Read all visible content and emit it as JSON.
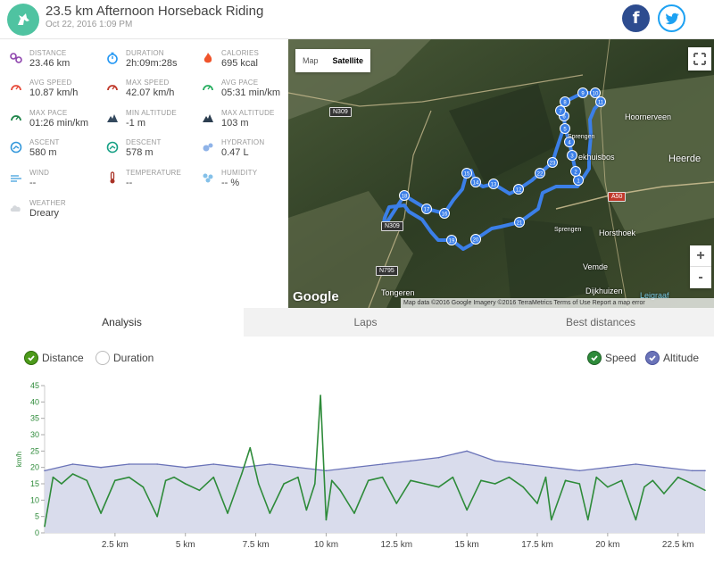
{
  "header": {
    "title": "23.5 km Afternoon Horseback Riding",
    "date": "Oct 22, 2016 1:09 PM"
  },
  "social": {
    "facebook_glyph": "f",
    "twitter_icon": "twitter-bird-icon"
  },
  "stats": [
    {
      "label": "DISTANCE",
      "value": "23.46 km",
      "icon": "route-icon",
      "color": "#8e44ad"
    },
    {
      "label": "DURATION",
      "value": "2h:09m:28s",
      "icon": "stopwatch-icon",
      "color": "#2196f3"
    },
    {
      "label": "CALORIES",
      "value": "695 kcal",
      "icon": "flame-icon",
      "color": "#f0542b"
    },
    {
      "label": "AVG SPEED",
      "value": "10.87 km/h",
      "icon": "speedometer-icon",
      "color": "#e74c3c"
    },
    {
      "label": "MAX SPEED",
      "value": "42.07 km/h",
      "icon": "speedometer-icon",
      "color": "#c0392b"
    },
    {
      "label": "AVG PACE",
      "value": "05:31 min/km",
      "icon": "gauge-icon",
      "color": "#27ae60"
    },
    {
      "label": "MAX PACE",
      "value": "01:26 min/km",
      "icon": "gauge-icon",
      "color": "#1e8449"
    },
    {
      "label": "MIN ALTITUDE",
      "value": "-1 m",
      "icon": "mountain-icon",
      "color": "#34495e"
    },
    {
      "label": "MAX ALTITUDE",
      "value": "103 m",
      "icon": "mountain-icon",
      "color": "#2c3e50"
    },
    {
      "label": "ASCENT",
      "value": "580 m",
      "icon": "ascent-icon",
      "color": "#3498db"
    },
    {
      "label": "DESCENT",
      "value": "578 m",
      "icon": "descent-icon",
      "color": "#16a085"
    },
    {
      "label": "HYDRATION",
      "value": "0.47 L",
      "icon": "drops-icon",
      "color": "#8fb3e8"
    },
    {
      "label": "WIND",
      "value": "--",
      "icon": "wind-icon",
      "color": "#5dade2"
    },
    {
      "label": "TEMPERATURE",
      "value": "--",
      "icon": "thermometer-icon",
      "color": "#a93226"
    },
    {
      "label": "HUMIDITY",
      "value": "-- %",
      "icon": "humidity-icon",
      "color": "#85c1e9"
    },
    {
      "label": "WEATHER",
      "value": "Dreary",
      "icon": "cloud-icon",
      "color": "#d5d8dc"
    }
  ],
  "map": {
    "toggle": [
      "Map",
      "Satellite"
    ],
    "active_toggle": "Satellite",
    "zoom_in": "+",
    "zoom_out": "-",
    "google": "Google",
    "attribution": "Map data ©2016 Google Imagery ©2016 TerraMetrics    Terms of Use    Report a map error",
    "places": [
      "Hoornerveen",
      "Heerde",
      "Horsthoek",
      "Vemde",
      "Dijkhuizen",
      "Tongeren",
      "Leigraaf",
      "Sprengen",
      "Sprengen",
      "ekhuisbos"
    ],
    "roads": [
      "N309",
      "N309",
      "N795",
      "A50"
    ],
    "waypoints": [
      "1",
      "2",
      "3",
      "4",
      "5",
      "6",
      "7",
      "8",
      "9",
      "10",
      "11",
      "12",
      "13",
      "14",
      "15",
      "16",
      "17",
      "18",
      "19",
      "20",
      "21",
      "22",
      "23"
    ]
  },
  "tabs": [
    {
      "label": "Analysis",
      "active": true
    },
    {
      "label": "Laps",
      "active": false
    },
    {
      "label": "Best distances",
      "active": false
    }
  ],
  "legend": {
    "x_options": [
      {
        "label": "Distance",
        "checked": true
      },
      {
        "label": "Duration",
        "checked": false
      }
    ],
    "series": [
      {
        "label": "Speed",
        "checked": true
      },
      {
        "label": "Altitude",
        "checked": true
      }
    ]
  },
  "chart_data": {
    "type": "line",
    "ylabel": "km/h",
    "xlabel": "",
    "ylim": [
      0,
      45
    ],
    "yticks": [
      0,
      5,
      10,
      15,
      20,
      25,
      30,
      35,
      40,
      45
    ],
    "xlim": [
      0,
      23.46
    ],
    "xticks": [
      "2.5 km",
      "5 km",
      "7.5 km",
      "10 km",
      "12.5 km",
      "15 km",
      "17.5 km",
      "20 km",
      "22.5 km"
    ],
    "xtick_values": [
      2.5,
      5,
      7.5,
      10,
      12.5,
      15,
      17.5,
      20,
      22.5
    ],
    "colors": {
      "speed": "#2e8b3a",
      "altitude_line": "#6a73b8",
      "altitude_fill": "#d9dcec"
    },
    "series": [
      {
        "name": "Speed",
        "x": [
          0,
          0.3,
          0.6,
          1,
          1.5,
          2,
          2.5,
          3,
          3.5,
          4,
          4.3,
          4.6,
          5,
          5.5,
          6,
          6.5,
          7,
          7.3,
          7.6,
          8,
          8.5,
          9,
          9.3,
          9.6,
          9.8,
          10,
          10.2,
          10.5,
          11,
          11.5,
          12,
          12.5,
          13,
          13.5,
          14,
          14.5,
          15,
          15.5,
          16,
          16.5,
          17,
          17.5,
          17.8,
          18,
          18.5,
          19,
          19.3,
          19.6,
          20,
          20.5,
          21,
          21.3,
          21.6,
          22,
          22.5,
          23,
          23.46
        ],
        "values": [
          2,
          17,
          15,
          18,
          16,
          6,
          16,
          17,
          14,
          5,
          16,
          17,
          15,
          13,
          17,
          6,
          18,
          26,
          15,
          6,
          15,
          17,
          7,
          15,
          42,
          4,
          16,
          13,
          6,
          16,
          17,
          9,
          16,
          15,
          14,
          17,
          7,
          16,
          15,
          17,
          14,
          9,
          17,
          4,
          16,
          15,
          4,
          17,
          14,
          16,
          4,
          14,
          16,
          12,
          17,
          15,
          13
        ]
      },
      {
        "name": "Altitude",
        "x": [
          0,
          1,
          2,
          3,
          4,
          5,
          6,
          7,
          8,
          9,
          10,
          11,
          12,
          13,
          14,
          15,
          16,
          17,
          18,
          19,
          20,
          21,
          22,
          23,
          23.46
        ],
        "values": [
          19,
          21,
          20,
          21,
          21,
          20,
          21,
          20,
          21,
          20,
          19,
          20,
          21,
          22,
          23,
          25,
          22,
          21,
          20,
          19,
          20,
          21,
          20,
          19,
          19
        ]
      }
    ]
  }
}
